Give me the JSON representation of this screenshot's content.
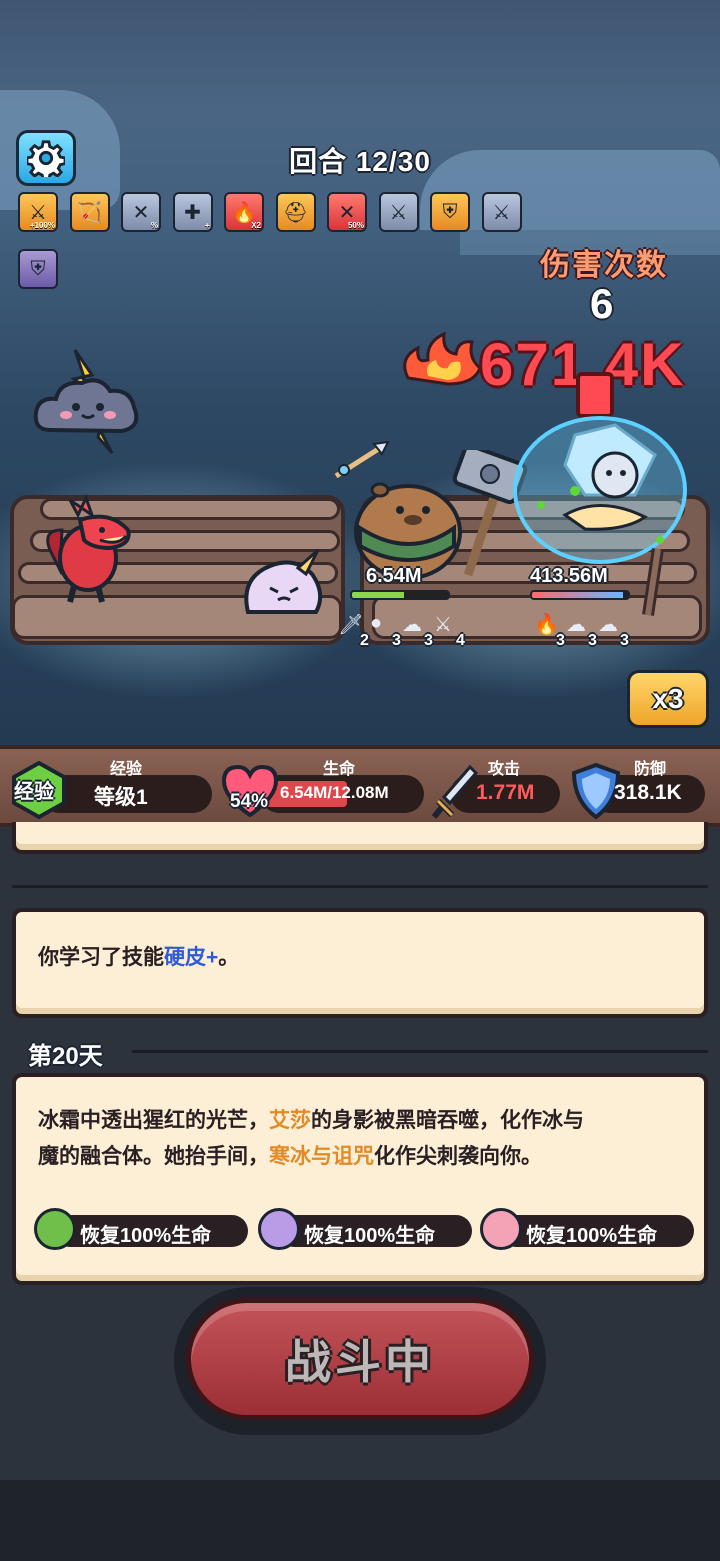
{
  "hud": {
    "settings_icon": "gear-icon",
    "round_label": "回合 12/30",
    "skills": [
      {
        "icon": "flaming-sword-icon",
        "badge": "+100%",
        "tone": "orange"
      },
      {
        "icon": "archer-icon",
        "badge": "",
        "tone": "orange"
      },
      {
        "icon": "crossed-swords-icon",
        "badge": "%",
        "tone": "gray"
      },
      {
        "icon": "sword-plus-icon",
        "badge": "+",
        "tone": "gray"
      },
      {
        "icon": "fire-icon",
        "badge": "X2",
        "tone": "red"
      },
      {
        "icon": "helmet-icon",
        "badge": "",
        "tone": "orange"
      },
      {
        "icon": "poison-swords-icon",
        "badge": "50%",
        "tone": "red"
      },
      {
        "icon": "flaming-sword-icon",
        "badge": "",
        "tone": "gray"
      },
      {
        "icon": "shield-up-icon",
        "badge": "",
        "tone": "orange"
      },
      {
        "icon": "flaming-sword-icon",
        "badge": "",
        "tone": "gray"
      },
      {
        "icon": "purple-shield-icon",
        "badge": "",
        "tone": "purple"
      }
    ],
    "damage_count_label": "伤害次数",
    "damage_count_value": "6",
    "damage_popup": "671.4K",
    "speed_button": "x3"
  },
  "battle": {
    "player": {
      "hp_text": "6.54M",
      "hp_fraction": 0.54,
      "buffs": [
        {
          "icon": "sword-icon",
          "count": "2"
        },
        {
          "icon": "slime-icon",
          "count": "3"
        },
        {
          "icon": "ghost-icon",
          "count": "3"
        },
        {
          "icon": "flaming-sword-icon",
          "count": "4"
        }
      ]
    },
    "enemy": {
      "hp_text": "413.56M",
      "hp_fraction": 0.95,
      "buffs": [
        {
          "icon": "fire-icon",
          "count": "3"
        },
        {
          "icon": "ghost-icon",
          "count": "3"
        },
        {
          "icon": "ghost-icon",
          "count": "3"
        }
      ]
    }
  },
  "stats": {
    "exp_badge": "经验",
    "exp_caption": "经验",
    "level": "等级1",
    "hp_caption": "生命",
    "hp_percent": "54%",
    "hp_value": "6.54M/12.08M",
    "hp_fraction": 0.54,
    "atk_caption": "攻击",
    "atk_value": "1.77M",
    "def_caption": "防御",
    "def_value": "318.1K",
    "colors": {
      "atk": "#ff5b5b",
      "text": "#ffffff",
      "hp_fill": "#e0474c"
    }
  },
  "log": {
    "learned_prefix": "你学习了技能",
    "learned_skill": "硬皮+",
    "learned_suffix": "。",
    "day_label": "第20天",
    "story": {
      "p1": "冰霜中透出猩红的光芒，",
      "name": "艾莎",
      "p2": "的身影被黑暗吞噬，化作冰与",
      "p3": "魔的融合体。她抬手间，",
      "skill": "寒冰与诅咒",
      "p4": "化作尖刺袭向你。"
    },
    "rewards": [
      {
        "icon": "turtle-icon",
        "text": "恢复100%生命"
      },
      {
        "icon": "bug-icon",
        "text": "恢复100%生命"
      },
      {
        "icon": "pig-icon",
        "text": "恢复100%生命"
      }
    ],
    "battle_button": "战斗中"
  }
}
